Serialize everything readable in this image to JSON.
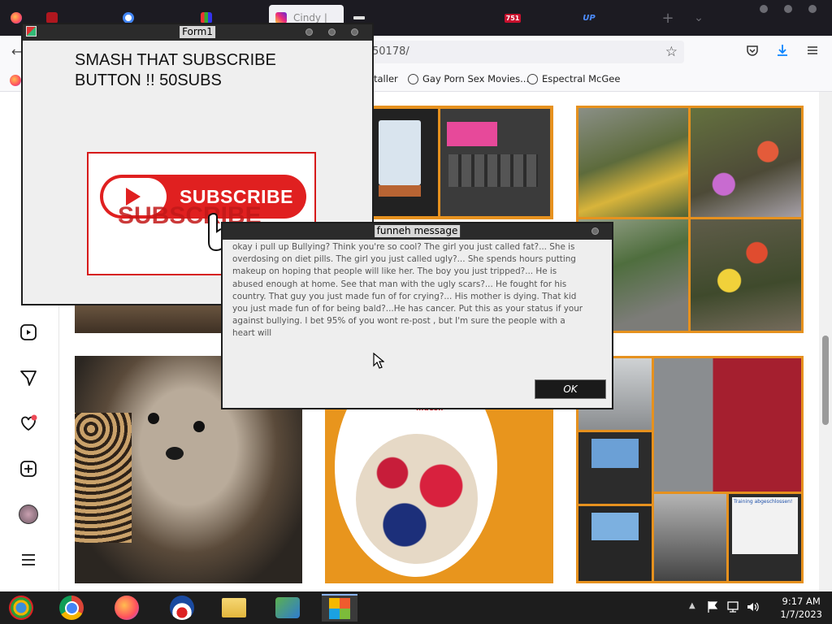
{
  "browser": {
    "tabs": [
      {
        "label": "",
        "icon": "firefox-icon"
      },
      {
        "label": "",
        "icon": "red-tab-icon"
      },
      {
        "label": "",
        "icon": "google-icon"
      },
      {
        "label": "",
        "icon": "bar-chart-icon"
      },
      {
        "label": "Cindy |",
        "icon": "instagram-icon"
      },
      {
        "label": "",
        "icon": "github-icon"
      },
      {
        "label": "751",
        "icon": "badge-icon"
      },
      {
        "label": "UP",
        "icon": "up-icon"
      }
    ],
    "url": "50178/",
    "bookmarks": [
      {
        "label": "taller"
      },
      {
        "label": "Gay Porn Sex Movies..."
      },
      {
        "label": "Espectral McGee"
      }
    ]
  },
  "form1": {
    "title": "Form1",
    "heading": "SMASH THAT SUBSCRIBE BUTTON !! 50SUBS",
    "subscribe_label": "SUBSCRIBE",
    "subscribe_shadow": "SUBSCRIBE"
  },
  "dialog": {
    "title": "funneh message",
    "body": "okay i pull up Bullying? Think you're so cool? The girl you just called fat?... She is overdosing on diet pills. The girl you just called ugly?... She spends hours putting makeup on hoping that people will like her. The boy you just tripped?... He is abused enough at home. See that man with the ugly scars?... He fought for his country. That guy you just made fun of for crying?... His mother is dying. That kid you just made fun of for being bald?...He has cancer. Put this as your status if your against bullying. I bet 95% of you wont re-post , but I'm sure the people with a heart will",
    "ok_label": "OK"
  },
  "photos": {
    "gym_text": "Training abgeschlossen!",
    "cereal_text": "muesli"
  },
  "taskbar": {
    "time": "9:17 AM",
    "date": "1/7/2023"
  },
  "colors": {
    "accent_red": "#e02020",
    "orange_frame": "#e8941a",
    "notification_dot": "#ed4956"
  }
}
